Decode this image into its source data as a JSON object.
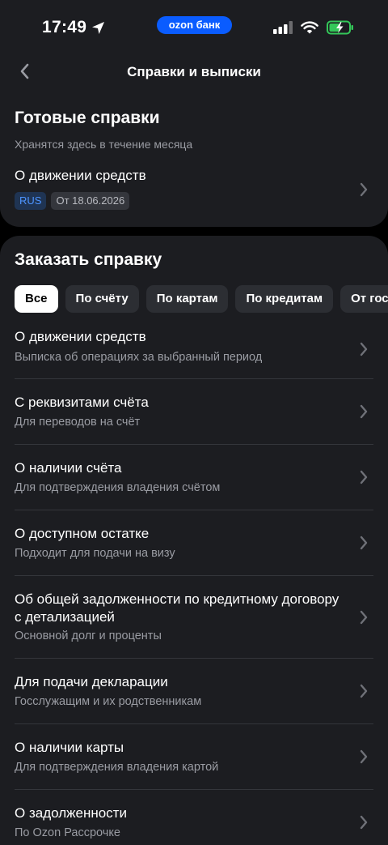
{
  "status_bar": {
    "time": "17:49",
    "bank_badge": "ozon банк",
    "colors": {
      "badge": "#0a5cff",
      "battery": "#34c759"
    }
  },
  "header": {
    "title": "Справки и выписки"
  },
  "ready": {
    "title": "Готовые справки",
    "subtitle": "Хранятся здесь в течение месяца",
    "item": {
      "title": "О движении средств",
      "tags": [
        "RUS",
        "От 18.06.2026"
      ]
    }
  },
  "order": {
    "title": "Заказать справку",
    "filters": [
      "Все",
      "По счёту",
      "По картам",
      "По кредитам",
      "От гос"
    ],
    "active_filter": "Все",
    "items": [
      {
        "title": "О движении средств",
        "subtitle": "Выписка об операциях за выбранный период"
      },
      {
        "title": "С реквизитами счёта",
        "subtitle": "Для переводов на счёт"
      },
      {
        "title": "О наличии счёта",
        "subtitle": "Для подтверждения владения счётом"
      },
      {
        "title": "О доступном остатке",
        "subtitle": "Подходит для подачи на визу"
      },
      {
        "title": "Об общей задолженности по кредитному договору с детализацией",
        "subtitle": "Основной долг и проценты"
      },
      {
        "title": "Для подачи декларации",
        "subtitle": "Госслужащим и их родственникам"
      },
      {
        "title": "О наличии карты",
        "subtitle": "Для подтверждения владения картой"
      },
      {
        "title": "О задолженности",
        "subtitle": "По Ozon Рассрочке"
      }
    ]
  },
  "icons": {
    "back": "chevron-left-icon",
    "row": "chevron-right-icon",
    "location": "location-arrow-icon",
    "signal": "cellular-signal-icon",
    "wifi": "wifi-icon",
    "battery": "battery-charging-icon"
  }
}
